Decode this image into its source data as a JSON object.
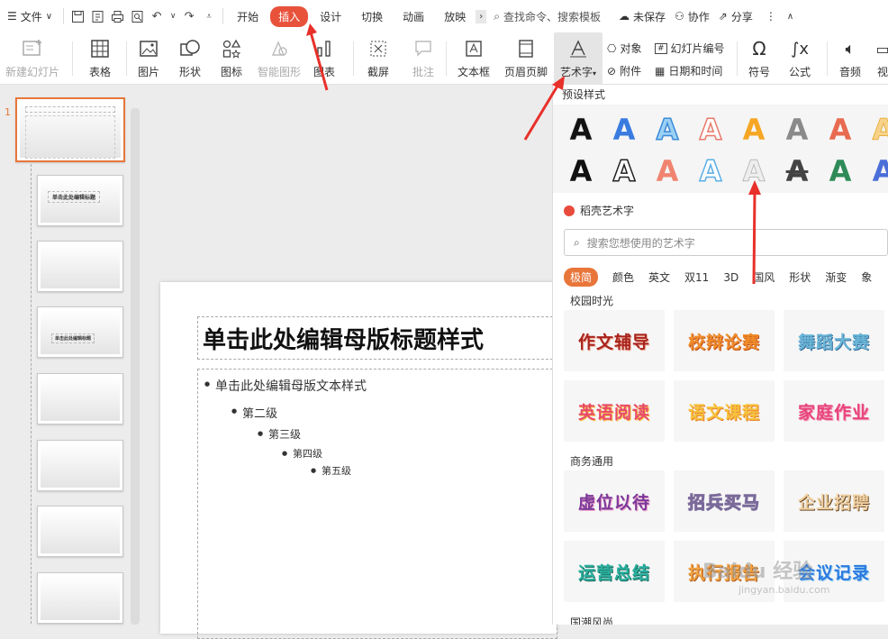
{
  "menubar": {
    "file_label": "文件",
    "tabs": [
      "开始",
      "插入",
      "设计",
      "切换",
      "动画",
      "放映"
    ],
    "search_placeholder": "查找命令、搜索模板",
    "unsaved": "未保存",
    "collab": "协作",
    "share": "分享"
  },
  "ribbon": {
    "new_slide": "新建幻灯片",
    "table": "表格",
    "picture": "图片",
    "shape": "形状",
    "icon": "图标",
    "smart": "智能图形",
    "chart": "图表",
    "screenshot": "截屏",
    "comment": "批注",
    "textbox": "文本框",
    "header_footer": "页眉页脚",
    "wordart": "艺术字",
    "object": "对象",
    "attachment": "附件",
    "slide_number": "幻灯片编号",
    "datetime": "日期和时间",
    "symbol": "符号",
    "formula": "公式",
    "audio": "音频",
    "video": "视"
  },
  "thumbs": {
    "first_number": "1",
    "slide2_title": "单击此处编辑标题",
    "slide4_title": "单击此处编辑标题"
  },
  "slide": {
    "title": "单击此处编辑母版标题样式",
    "levels": [
      "单击此处编辑母版文本样式",
      "第二级",
      "第三级",
      "第四级",
      "第五级"
    ]
  },
  "panel": {
    "preset_title": "预设样式",
    "daoke_label": "稻壳艺术字",
    "search_placeholder": "搜索您想使用的艺术字",
    "categories": [
      "极简",
      "颜色",
      "英文",
      "双11",
      "3D",
      "国风",
      "形状",
      "渐变",
      "象"
    ],
    "section1": "校园时光",
    "section2": "商务通用",
    "section3": "国潮风尚",
    "cards1": [
      "作文辅导",
      "校辩论赛",
      "舞蹈大赛",
      "英语阅读",
      "语文课程",
      "家庭作业"
    ],
    "cards2": [
      "虚位以待",
      "招兵买马",
      "企业招聘",
      "运营总结",
      "执行报告",
      "会议记录"
    ],
    "preset_glyph": "A"
  },
  "watermark": {
    "text": "Baidu 经验",
    "url": "jingyan.baidu.com"
  },
  "colors": {
    "accent": "#e8523b",
    "orange": "#e8763b"
  }
}
